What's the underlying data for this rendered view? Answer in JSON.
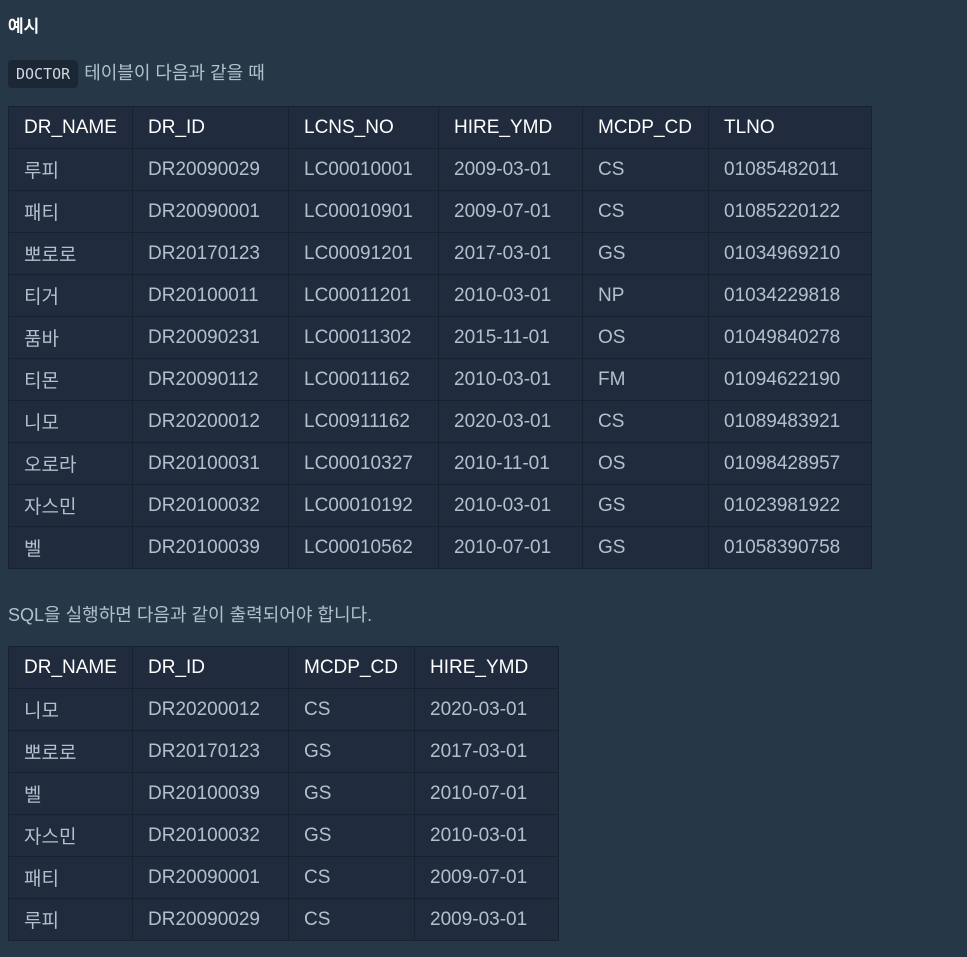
{
  "heading": "예시",
  "intro": {
    "code": "DOCTOR",
    "text": "테이블이 다음과 같을 때"
  },
  "result_text": "SQL을 실행하면 다음과 같이 출력되어야 합니다.",
  "doctor_table": {
    "headers": [
      "DR_NAME",
      "DR_ID",
      "LCNS_NO",
      "HIRE_YMD",
      "MCDP_CD",
      "TLNO"
    ],
    "rows": [
      [
        "루피",
        "DR20090029",
        "LC00010001",
        "2009-03-01",
        "CS",
        "01085482011"
      ],
      [
        "패티",
        "DR20090001",
        "LC00010901",
        "2009-07-01",
        "CS",
        "01085220122"
      ],
      [
        "뽀로로",
        "DR20170123",
        "LC00091201",
        "2017-03-01",
        "GS",
        "01034969210"
      ],
      [
        "티거",
        "DR20100011",
        "LC00011201",
        "2010-03-01",
        "NP",
        "01034229818"
      ],
      [
        "품바",
        "DR20090231",
        "LC00011302",
        "2015-11-01",
        "OS",
        "01049840278"
      ],
      [
        "티몬",
        "DR20090112",
        "LC00011162",
        "2010-03-01",
        "FM",
        "01094622190"
      ],
      [
        "니모",
        "DR20200012",
        "LC00911162",
        "2020-03-01",
        "CS",
        "01089483921"
      ],
      [
        "오로라",
        "DR20100031",
        "LC00010327",
        "2010-11-01",
        "OS",
        "01098428957"
      ],
      [
        "자스민",
        "DR20100032",
        "LC00010192",
        "2010-03-01",
        "GS",
        "01023981922"
      ],
      [
        "벨",
        "DR20100039",
        "LC00010562",
        "2010-07-01",
        "GS",
        "01058390758"
      ]
    ]
  },
  "result_table": {
    "headers": [
      "DR_NAME",
      "DR_ID",
      "MCDP_CD",
      "HIRE_YMD"
    ],
    "rows": [
      [
        "니모",
        "DR20200012",
        "CS",
        "2020-03-01"
      ],
      [
        "뽀로로",
        "DR20170123",
        "GS",
        "2017-03-01"
      ],
      [
        "벨",
        "DR20100039",
        "GS",
        "2010-07-01"
      ],
      [
        "자스민",
        "DR20100032",
        "GS",
        "2010-03-01"
      ],
      [
        "패티",
        "DR20090001",
        "CS",
        "2009-07-01"
      ],
      [
        "루피",
        "DR20090029",
        "CS",
        "2009-03-01"
      ]
    ]
  },
  "colors": {
    "background": "#263747",
    "table_background": "#202b3d",
    "header_text": "#ffffff",
    "body_text": "#b2c0cc"
  }
}
